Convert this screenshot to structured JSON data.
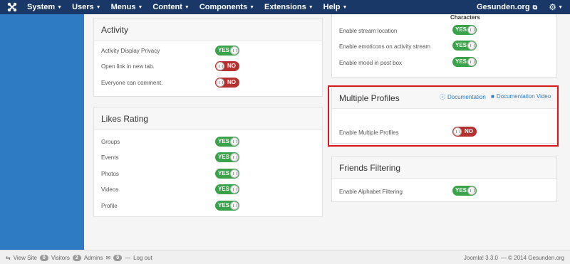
{
  "topbar": {
    "menu": [
      "System",
      "Users",
      "Menus",
      "Content",
      "Components",
      "Extensions",
      "Help"
    ],
    "site_name": "Gesunden.org"
  },
  "left_top_panel": {
    "title": "Activity",
    "rows": [
      {
        "label": "Activity Display Privacy",
        "value": "YES"
      },
      {
        "label": "Open link in new tab.",
        "value": "NO"
      },
      {
        "label": "Everyone can comment.",
        "value": "NO"
      }
    ]
  },
  "likes_panel": {
    "title": "Likes Rating",
    "rows": [
      {
        "label": "Groups",
        "value": "YES"
      },
      {
        "label": "Events",
        "value": "YES"
      },
      {
        "label": "Photos",
        "value": "YES"
      },
      {
        "label": "Videos",
        "value": "YES"
      },
      {
        "label": "Profile",
        "value": "YES"
      }
    ]
  },
  "right_top_panel": {
    "partial_heading": "Characters",
    "rows": [
      {
        "label": "Enable stream location",
        "value": "YES"
      },
      {
        "label": "Enable emoticons on activity stream",
        "value": "YES"
      },
      {
        "label": "Enable mood in post box",
        "value": "YES"
      }
    ]
  },
  "multiple_profiles": {
    "title": "Multiple Profiles",
    "doc_label": "Documentation",
    "video_label": "Documentation Video",
    "rows": [
      {
        "label": "Enable Multiple Profiles",
        "value": "NO"
      }
    ]
  },
  "friends_filtering": {
    "title": "Friends Filtering",
    "rows": [
      {
        "label": "Enable Alphabet Filtering",
        "value": "YES"
      }
    ]
  },
  "footer": {
    "view_site": "View Site",
    "visitors_count": "0",
    "visitors_label": "Visitors",
    "admins_count": "2",
    "admins_label": "Admins",
    "messages_count": "0",
    "logout": "Log out",
    "version": "Joomla! 3.3.0",
    "copyright": "— © 2014 Gesunden.org"
  },
  "colors": {
    "nav": "#1a3867",
    "sidebar": "#2f7bc3",
    "yes": "#3aa34a",
    "no": "#b5302f",
    "highlight": "#d9181c"
  }
}
